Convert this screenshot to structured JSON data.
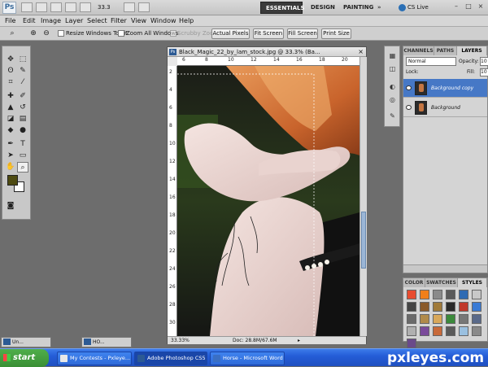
{
  "app": {
    "logo": "Ps",
    "zoom": "33.3",
    "workspaces": [
      "ESSENTIALS",
      "DESIGN",
      "PAINTING"
    ],
    "more_workspaces": "»",
    "cs_live": "CS Live"
  },
  "menu": [
    "File",
    "Edit",
    "Image",
    "Layer",
    "Select",
    "Filter",
    "View",
    "Window",
    "Help"
  ],
  "options": {
    "resize_windows": "Resize Windows To Fit",
    "zoom_all": "Zoom All Windows",
    "scrubby_zoom": "Scrubby Zoom",
    "actual_pixels": "Actual Pixels",
    "fit_screen": "Fit Screen",
    "fill_screen": "Fill Screen",
    "print_size": "Print Size"
  },
  "document": {
    "title": "Black_Magic_22_by_lam_stock.jpg @ 33.3% (Ba...",
    "ruler_h": [
      "6",
      "8",
      "10",
      "12",
      "14",
      "16",
      "18",
      "20"
    ],
    "ruler_v": [
      "2",
      "4",
      "6",
      "8",
      "10",
      "12",
      "14",
      "16",
      "18",
      "20",
      "22",
      "24",
      "26",
      "28",
      "30"
    ],
    "zoom_status": "33.33%",
    "doc_status": "Doc: 28.8M/67.6M"
  },
  "layers_panel": {
    "tabs": [
      "CHANNELS",
      "PATHS",
      "LAYERS"
    ],
    "blend_mode": "Normal",
    "opacity_label": "Opacity:",
    "opacity_value": "10",
    "lock_label": "Lock:",
    "fill_label": "Fill:",
    "fill_value": "10",
    "layers": [
      {
        "name": "Background copy"
      },
      {
        "name": "Background"
      }
    ]
  },
  "styles_panel": {
    "tabs": [
      "COLOR",
      "SWATCHES",
      "STYLES"
    ],
    "swatch_colors": [
      "#e84c2f",
      "#f07f1a",
      "#8a8a8a",
      "#5a5a5a",
      "#2f6bb3",
      "#c8c8c8",
      "#444444",
      "#8a5a2a",
      "#a07a3a",
      "#2a2a2a",
      "#c0392b",
      "#3a7bd5",
      "#6a6a6a",
      "#b08a4a",
      "#d9a85a",
      "#3b8a3b",
      "#777777",
      "#5a6a8a",
      "#b0b0b0",
      "#7a4a9a",
      "#c86a3a",
      "#5a5a5a",
      "#9ac0e0",
      "#8a8a8a",
      "#6a4a8a"
    ]
  },
  "minimized_docs": [
    "Un...",
    "HO..."
  ],
  "taskbar": {
    "start": "start",
    "tasks": [
      "My Contests - Pxleye...",
      "Adobe Photoshop CS5",
      "Horse - Microsoft Word"
    ],
    "brand": "pxleyes.com"
  },
  "colors": {
    "foreground": "#4e4b12",
    "background": "#ffffff",
    "layer_selected": "#4678c6",
    "taskbar": "#245dd7"
  }
}
